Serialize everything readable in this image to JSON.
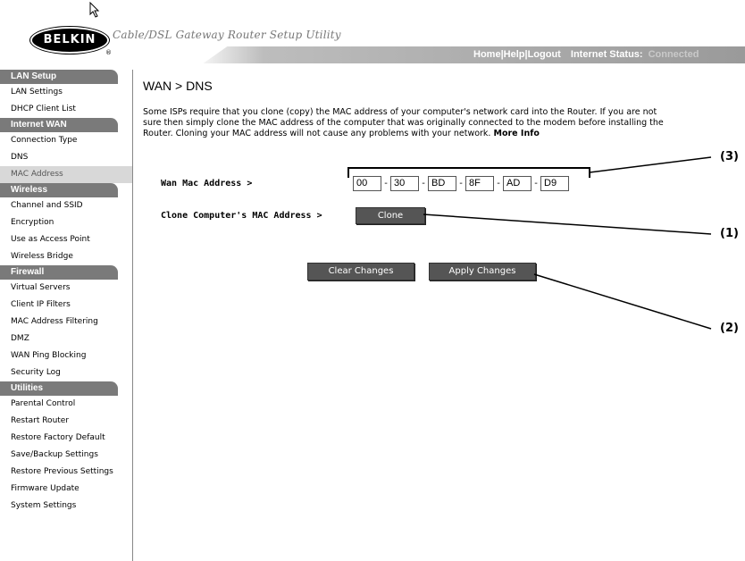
{
  "header": {
    "brand": "BELKIN",
    "app_title": "Cable/DSL Gateway Router Setup Utility",
    "nav": {
      "home": "Home",
      "help": "Help",
      "logout": "Logout",
      "status_label": "Internet Status:",
      "status_value": "Connected"
    }
  },
  "sidebar": {
    "sections": [
      {
        "title": "LAN Setup",
        "items": [
          "LAN Settings",
          "DHCP Client List"
        ]
      },
      {
        "title": "Internet WAN",
        "items": [
          "Connection Type",
          "DNS",
          "MAC Address"
        ]
      },
      {
        "title": "Wireless",
        "items": [
          "Channel and SSID",
          "Encryption",
          "Use as Access Point",
          "Wireless Bridge"
        ]
      },
      {
        "title": "Firewall",
        "items": [
          "Virtual Servers",
          "Client IP Filters",
          "MAC Address Filtering",
          "DMZ",
          "WAN Ping Blocking",
          "Security Log"
        ]
      },
      {
        "title": "Utilities",
        "items": [
          "Parental Control",
          "Restart Router",
          "Restore Factory Default",
          "Save/Backup Settings",
          "Restore Previous Settings",
          "Firmware Update",
          "System Settings"
        ]
      }
    ],
    "active_item": "MAC Address"
  },
  "main": {
    "title": "WAN > DNS",
    "description": "Some ISPs require that you clone (copy) the MAC address of your computer's network card into the Router. If you are not sure then simply clone the MAC address of the computer that was originally connected to the modem before installing the Router. Cloning your MAC address will not cause any problems with your network.",
    "more_info": "More Info",
    "wan_mac_label": "Wan Mac Address >",
    "mac_octets": [
      "00",
      "30",
      "BD",
      "8F",
      "AD",
      "D9"
    ],
    "clone_label": "Clone Computer's MAC Address >",
    "clone_button": "Clone",
    "clear_button": "Clear Changes",
    "apply_button": "Apply Changes"
  },
  "callouts": {
    "c1": "(1)",
    "c2": "(2)",
    "c3": "(3)"
  }
}
